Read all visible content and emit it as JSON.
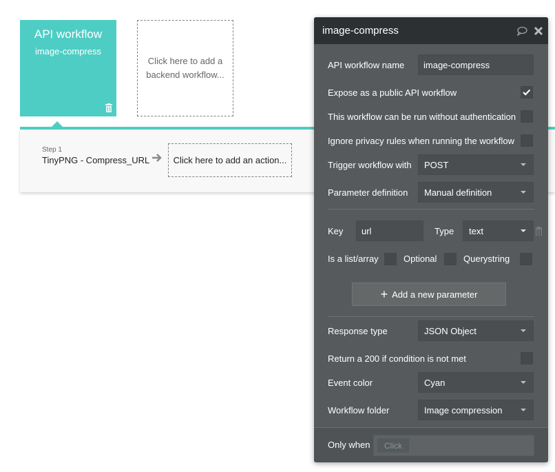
{
  "canvas": {
    "workflow_card": {
      "title": "API workflow",
      "subtitle": "image-compress"
    },
    "add_backend": "Click here to add a backend workflow...",
    "steps": [
      {
        "num": "Step 1",
        "name": "TinyPNG - Compress_URL"
      }
    ],
    "add_action": "Click here to add an action..."
  },
  "panel": {
    "title": "image-compress",
    "name_label": "API workflow name",
    "name_value": "image-compress",
    "expose_label": "Expose as a public API workflow",
    "expose_checked": true,
    "no_auth_label": "This workflow can be run without authentication",
    "no_auth_checked": false,
    "ignore_privacy_label": "Ignore privacy rules when running the workflow",
    "ignore_privacy_checked": false,
    "trigger_label": "Trigger workflow with",
    "trigger_value": "POST",
    "param_def_label": "Parameter definition",
    "param_def_value": "Manual definition",
    "key_label": "Key",
    "key_value": "url",
    "type_label": "Type",
    "type_value": "text",
    "is_list_label": "Is a list/array",
    "optional_label": "Optional",
    "querystring_label": "Querystring",
    "add_param_label": "Add a new parameter",
    "response_type_label": "Response type",
    "response_type_value": "JSON Object",
    "return200_label": "Return a 200 if condition is not met",
    "event_color_label": "Event color",
    "event_color_value": "Cyan",
    "folder_label": "Workflow folder",
    "folder_value": "Image compression",
    "only_when_label": "Only when",
    "only_when_placeholder": "Click"
  },
  "colors": {
    "accent": "#4ecdc4",
    "panel_bg": "#565a5c",
    "panel_header": "#2c3033"
  }
}
